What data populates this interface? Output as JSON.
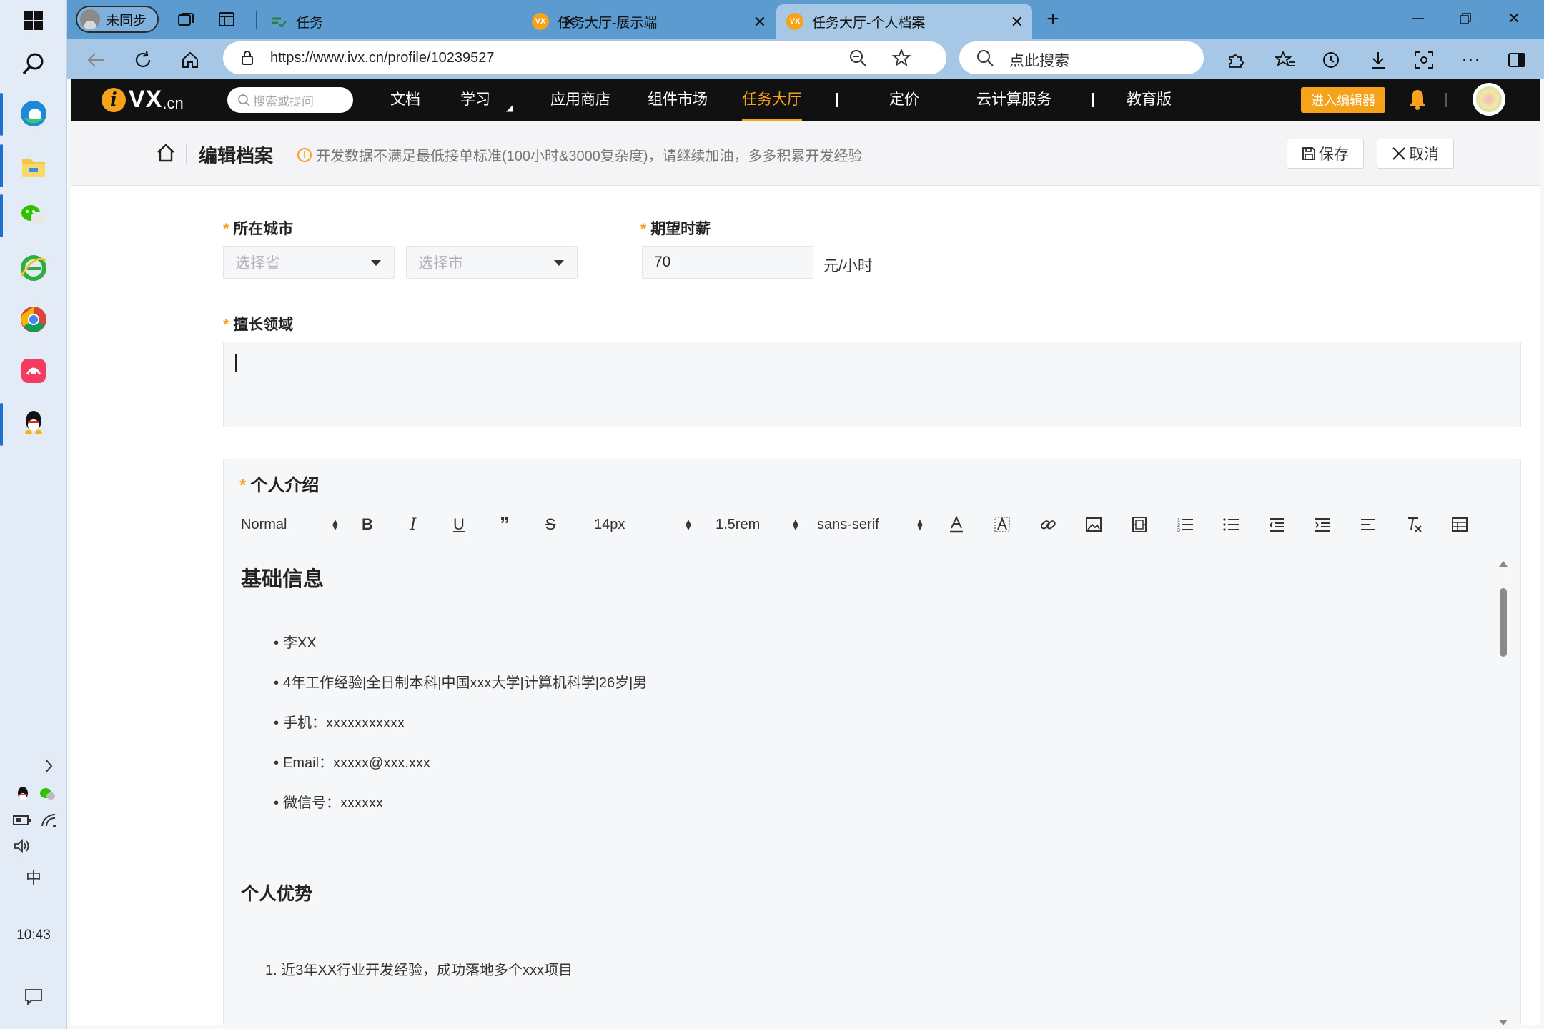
{
  "taskbar": {
    "clock": "10:43",
    "ime": "中"
  },
  "browser": {
    "profile_label": "未同步",
    "tabs": [
      {
        "label": "任务"
      },
      {
        "label": "任务大厅-展示端"
      },
      {
        "label": "任务大厅-个人档案"
      }
    ],
    "url": "https://www.ivx.cn/profile/10239527",
    "search_placeholder": "点此搜索"
  },
  "site": {
    "logo_vx": "VX",
    "logo_cn": ".cn",
    "search_placeholder": "搜索或提问",
    "nav": [
      "文档",
      "学习",
      "应用商店",
      "组件市场",
      "任务大厅",
      "定价",
      "云计算服务",
      "教育版"
    ],
    "active_nav": "任务大厅",
    "enter_editor": "进入编辑器",
    "accent_color": "#f6a21b"
  },
  "editbar": {
    "title": "编辑档案",
    "warning": "开发数据不满足最低接单标准(100小时&3000复杂度)，请继续加油，多多积累开发经验",
    "save": "保存",
    "cancel": "取消"
  },
  "form": {
    "city_label": "所在城市",
    "province_placeholder": "选择省",
    "city_placeholder": "选择市",
    "salary_label": "期望时薪",
    "salary_value": "70",
    "salary_unit": "元/小时",
    "domain_label": "擅长领域",
    "domain_value": "",
    "intro_label": "个人介绍"
  },
  "editor_toolbar": {
    "header_select": "Normal",
    "size_select": "14px",
    "lineheight_select": "1.5rem",
    "font_select": "sans-serif"
  },
  "intro_content": {
    "section1_title": "基础信息",
    "items": [
      "李XX",
      "4年工作经验|全日制本科|中国xxx大学|计算机科学|26岁|男",
      "手机：xxxxxxxxxxx",
      "Email：xxxxx@xxx.xxx",
      "微信号：xxxxxx"
    ],
    "section2_title": "个人优势",
    "ordered_items": [
      "1. 近3年XX行业开发经验，成功落地多个xxx项目"
    ]
  }
}
